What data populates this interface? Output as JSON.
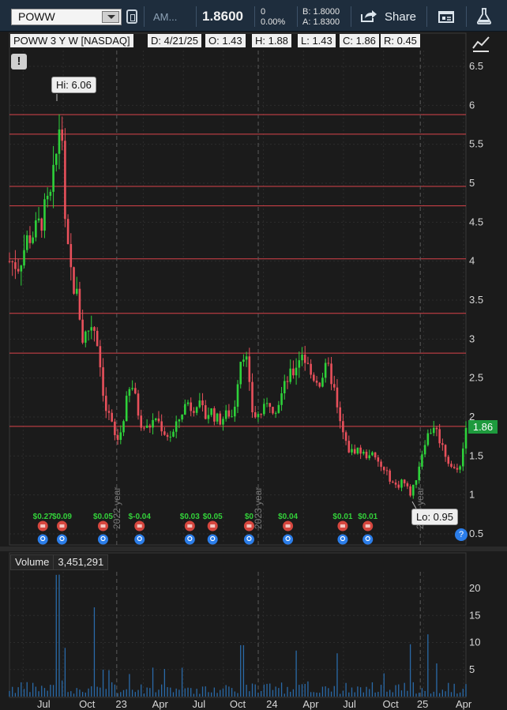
{
  "toolbar": {
    "symbol": "POWW",
    "description": "AM...",
    "last": "1.8600",
    "net_change": "0",
    "pct_change": "0.00%",
    "bid": "B: 1.8000",
    "ask": "A: 1.8300",
    "share_label": "Share"
  },
  "header": {
    "title": "POWW 3 Y W [NASDAQ]",
    "date": "D: 4/21/25",
    "open": "O: 1.43",
    "high": "H: 1.88",
    "low": "L: 1.43",
    "close": "C: 1.86",
    "range": "R: 0.45"
  },
  "annotations": {
    "hi": "Hi: 6.06",
    "lo": "Lo: 0.95",
    "last_badge": "1.86"
  },
  "volume": {
    "label": "Volume",
    "value": "3,451,291"
  },
  "colors": {
    "up": "#2ed13a",
    "down": "#e8505b",
    "grid": "#2c2c2c",
    "level": "#d9434b",
    "volume": "#2a6aa8"
  },
  "chart_data": {
    "type": "candlestick",
    "title": "POWW 3 Y W [NASDAQ]",
    "price_axis": {
      "ticks": [
        0.5,
        1,
        1.5,
        2,
        2.5,
        3,
        3.5,
        4,
        4.5,
        5,
        5.5,
        6,
        6.5
      ],
      "ylim": [
        0.5,
        6.5
      ]
    },
    "volume_axis": {
      "ticks": [
        5,
        10,
        15,
        20
      ],
      "label": "Volume"
    },
    "x_ticks": [
      "Jul",
      "Oct",
      "23",
      "Apr",
      "Jul",
      "Oct",
      "24",
      "Apr",
      "Jul",
      "Oct",
      "25",
      "Apr"
    ],
    "year_markers": [
      "2022 year",
      "2023 year",
      "2024 year"
    ],
    "levels": [
      5.88,
      5.63,
      4.96,
      4.71,
      4.03,
      3.33,
      2.82,
      1.88
    ],
    "high": 6.06,
    "low": 0.95,
    "last": 1.86,
    "dividends": [
      {
        "label": "$0.27",
        "x": 0.073
      },
      {
        "label": "$0.09",
        "x": 0.115
      },
      {
        "label": "$0.05",
        "x": 0.205
      },
      {
        "label": "$-0.04",
        "x": 0.285
      },
      {
        "label": "$0.03",
        "x": 0.395
      },
      {
        "label": "$0.05",
        "x": 0.445
      },
      {
        "label": "$0",
        "x": 0.525
      },
      {
        "label": "$0.04",
        "x": 0.61
      },
      {
        "label": "$0.01",
        "x": 0.73
      },
      {
        "label": "$0.01",
        "x": 0.785
      }
    ],
    "close_path": [
      [
        0.0,
        4.0
      ],
      [
        0.02,
        3.95
      ],
      [
        0.04,
        4.3
      ],
      [
        0.06,
        4.4
      ],
      [
        0.075,
        4.6
      ],
      [
        0.09,
        4.8
      ],
      [
        0.1,
        5.2
      ],
      [
        0.11,
        5.8
      ],
      [
        0.115,
        5.7
      ],
      [
        0.12,
        4.5
      ],
      [
        0.13,
        4.0
      ],
      [
        0.14,
        3.7
      ],
      [
        0.15,
        3.5
      ],
      [
        0.16,
        3.0
      ],
      [
        0.17,
        3.1
      ],
      [
        0.18,
        3.2
      ],
      [
        0.19,
        3.1
      ],
      [
        0.2,
        2.6
      ],
      [
        0.21,
        2.1
      ],
      [
        0.22,
        2.0
      ],
      [
        0.23,
        1.75
      ],
      [
        0.24,
        1.7
      ],
      [
        0.25,
        2.0
      ],
      [
        0.26,
        2.3
      ],
      [
        0.27,
        2.4
      ],
      [
        0.28,
        2.1
      ],
      [
        0.29,
        1.9
      ],
      [
        0.3,
        1.85
      ],
      [
        0.31,
        1.9
      ],
      [
        0.32,
        2.0
      ],
      [
        0.33,
        1.9
      ],
      [
        0.34,
        1.8
      ],
      [
        0.35,
        1.75
      ],
      [
        0.36,
        1.8
      ],
      [
        0.37,
        1.95
      ],
      [
        0.38,
        2.1
      ],
      [
        0.39,
        2.2
      ],
      [
        0.4,
        2.1
      ],
      [
        0.41,
        2.2
      ],
      [
        0.42,
        2.1
      ],
      [
        0.43,
        2.0
      ],
      [
        0.44,
        2.1
      ],
      [
        0.45,
        2.0
      ],
      [
        0.46,
        1.95
      ],
      [
        0.47,
        2.0
      ],
      [
        0.48,
        2.05
      ],
      [
        0.49,
        2.0
      ],
      [
        0.5,
        2.5
      ],
      [
        0.51,
        2.9
      ],
      [
        0.52,
        2.7
      ],
      [
        0.53,
        2.1
      ],
      [
        0.54,
        2.0
      ],
      [
        0.55,
        2.05
      ],
      [
        0.56,
        2.1
      ],
      [
        0.57,
        2.2
      ],
      [
        0.58,
        2.1
      ],
      [
        0.59,
        2.2
      ],
      [
        0.6,
        2.35
      ],
      [
        0.61,
        2.5
      ],
      [
        0.62,
        2.55
      ],
      [
        0.63,
        2.7
      ],
      [
        0.64,
        2.85
      ],
      [
        0.65,
        2.7
      ],
      [
        0.66,
        2.55
      ],
      [
        0.67,
        2.5
      ],
      [
        0.68,
        2.45
      ],
      [
        0.69,
        2.6
      ],
      [
        0.7,
        2.6
      ],
      [
        0.71,
        2.4
      ],
      [
        0.72,
        2.0
      ],
      [
        0.73,
        1.8
      ],
      [
        0.74,
        1.6
      ],
      [
        0.75,
        1.55
      ],
      [
        0.76,
        1.6
      ],
      [
        0.77,
        1.55
      ],
      [
        0.78,
        1.5
      ],
      [
        0.79,
        1.55
      ],
      [
        0.8,
        1.45
      ],
      [
        0.81,
        1.4
      ],
      [
        0.82,
        1.3
      ],
      [
        0.83,
        1.25
      ],
      [
        0.84,
        1.15
      ],
      [
        0.85,
        1.1
      ],
      [
        0.86,
        1.2
      ],
      [
        0.87,
        1.1
      ],
      [
        0.88,
        1.0
      ],
      [
        0.89,
        1.2
      ],
      [
        0.9,
        1.45
      ],
      [
        0.91,
        1.7
      ],
      [
        0.92,
        1.8
      ],
      [
        0.93,
        1.9
      ],
      [
        0.94,
        1.75
      ],
      [
        0.95,
        1.6
      ],
      [
        0.96,
        1.45
      ],
      [
        0.97,
        1.35
      ],
      [
        0.98,
        1.3
      ],
      [
        0.99,
        1.45
      ],
      [
        1.0,
        1.86
      ]
    ],
    "volume_spikes": [
      {
        "x": 0.105,
        "v": 22.5
      },
      {
        "x": 0.185,
        "v": 16.5
      },
      {
        "x": 0.51,
        "v": 9.5
      },
      {
        "x": 0.63,
        "v": 8.5
      },
      {
        "x": 0.72,
        "v": 8.0
      },
      {
        "x": 0.915,
        "v": 11.5
      },
      {
        "x": 0.88,
        "v": 6.0
      },
      {
        "x": 0.12,
        "v": 9.0
      }
    ]
  }
}
